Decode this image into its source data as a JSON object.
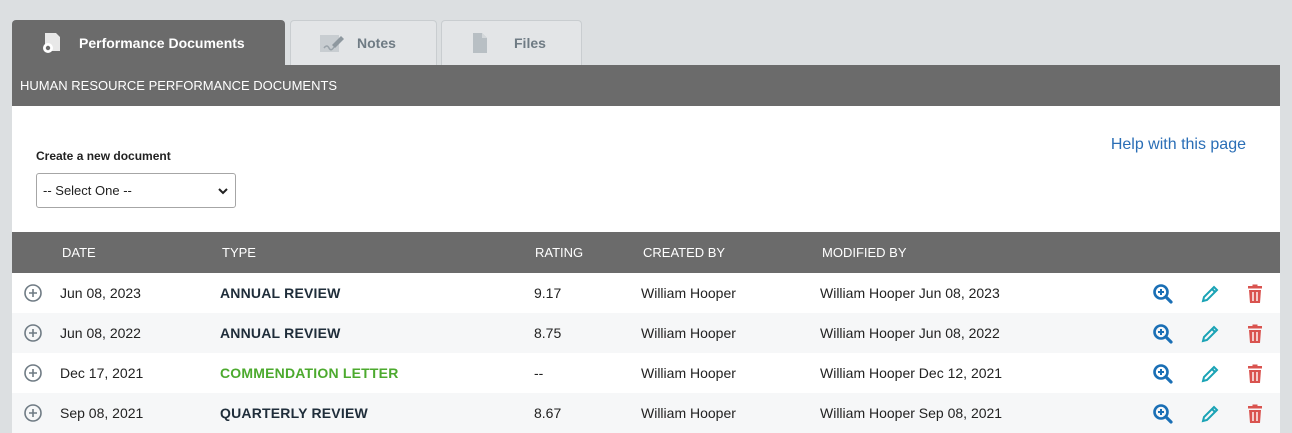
{
  "tabs": [
    {
      "label": "Performance Documents",
      "icon": "document-badge-icon",
      "active": true
    },
    {
      "label": "Notes",
      "icon": "notes-pencil-icon",
      "active": false
    },
    {
      "label": "Files",
      "icon": "file-icon",
      "active": false
    }
  ],
  "section": {
    "title": "HUMAN RESOURCE PERFORMANCE DOCUMENTS"
  },
  "create": {
    "label": "Create a new document",
    "select_value": "-- Select One --"
  },
  "help": {
    "label": "Help with this page"
  },
  "table": {
    "columns": [
      "DATE",
      "TYPE",
      "RATING",
      "CREATED BY",
      "MODIFIED BY"
    ],
    "rows": [
      {
        "date": "Jun 08, 2023",
        "type": "ANNUAL REVIEW",
        "rating": "9.17",
        "created_by": "William Hooper",
        "modified_by": "William Hooper Jun 08, 2023"
      },
      {
        "date": "Jun 08, 2022",
        "type": "ANNUAL REVIEW",
        "rating": "8.75",
        "created_by": "William Hooper",
        "modified_by": "William Hooper Jun 08, 2022"
      },
      {
        "date": "Dec 17, 2021",
        "type": "COMMENDATION LETTER",
        "rating": "--",
        "created_by": "William Hooper",
        "modified_by": "William Hooper Dec 12, 2021"
      },
      {
        "date": "Sep 08, 2021",
        "type": "QUARTERLY REVIEW",
        "rating": "8.67",
        "created_by": "William Hooper",
        "modified_by": "William Hooper Sep 08, 2021"
      }
    ]
  },
  "colors": {
    "header_bg": "#6b6b6b",
    "link": "#2a6eb6",
    "view_icon": "#1a6fb5",
    "edit_icon": "#1aa3b5",
    "delete_icon": "#d9534f",
    "commendation_type": "#4caa2e"
  }
}
